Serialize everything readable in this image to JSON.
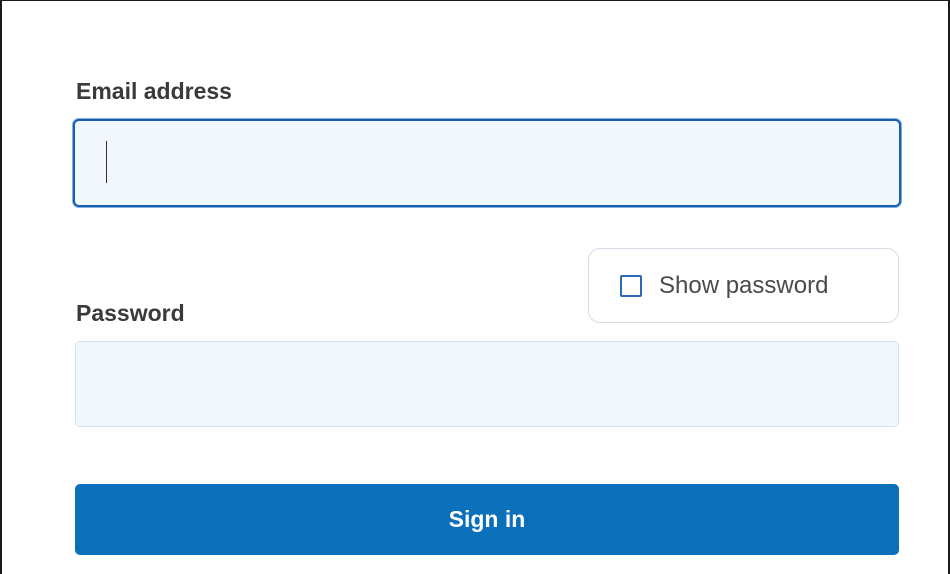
{
  "form": {
    "email_label": "Email address",
    "email_value": "",
    "show_password_label": "Show password",
    "show_password_checked": false,
    "password_label": "Password",
    "password_value": "",
    "sign_in_label": "Sign in"
  },
  "colors": {
    "primary": "#0b6fba",
    "input_background": "#f2f7fe",
    "focus_border": "#1a5fa8",
    "label_text": "#3a3a3a"
  },
  "icons": {
    "checkbox": "checkbox-unchecked-icon"
  }
}
